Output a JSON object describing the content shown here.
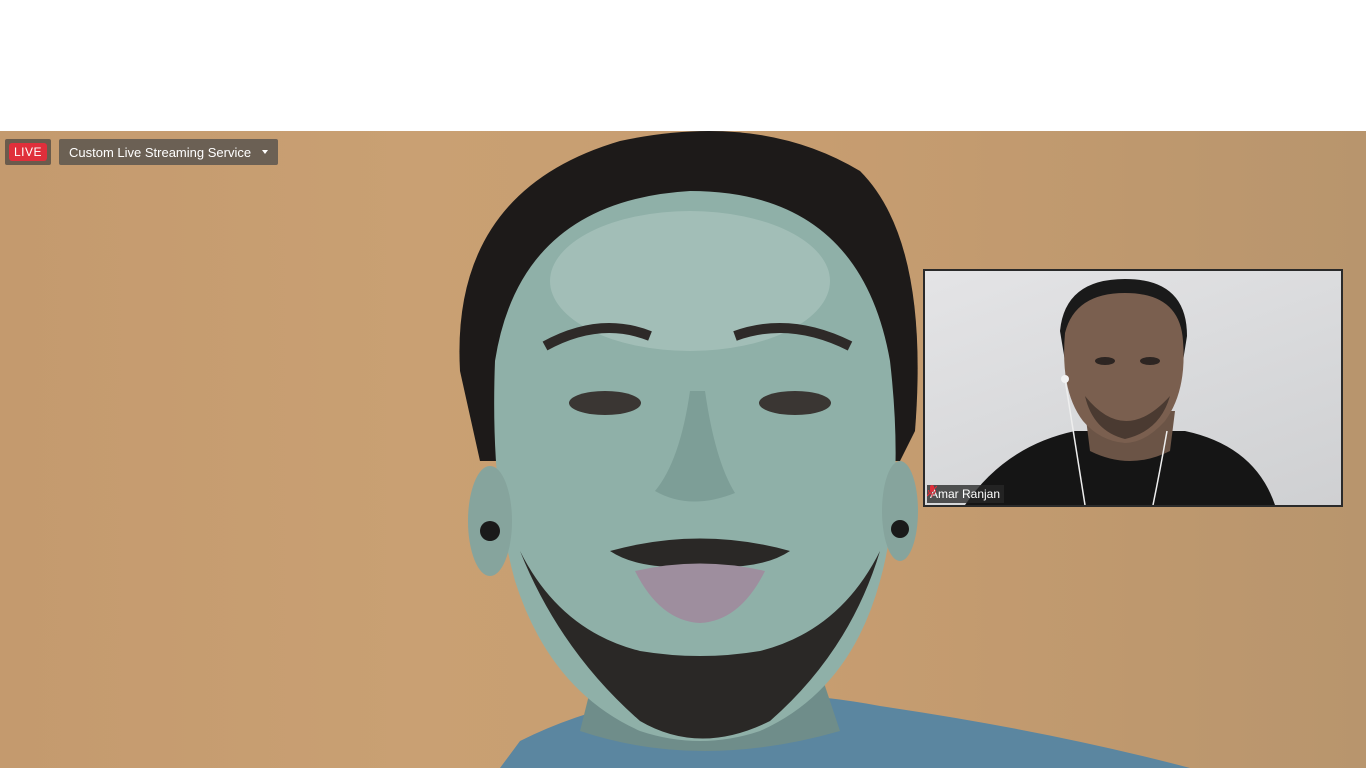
{
  "live_badge": {
    "label": "LIVE",
    "color": "#e02f3b"
  },
  "stream_service": {
    "label": "Custom Live Streaming Service",
    "icon": "caret-down-icon"
  },
  "main_speaker": {
    "description_icon": "video-feed"
  },
  "thumbnail": {
    "participant_name": "Amar Ranjan",
    "mic_status_icon": "mic-muted-icon",
    "mic_color": "#e02f3b"
  }
}
